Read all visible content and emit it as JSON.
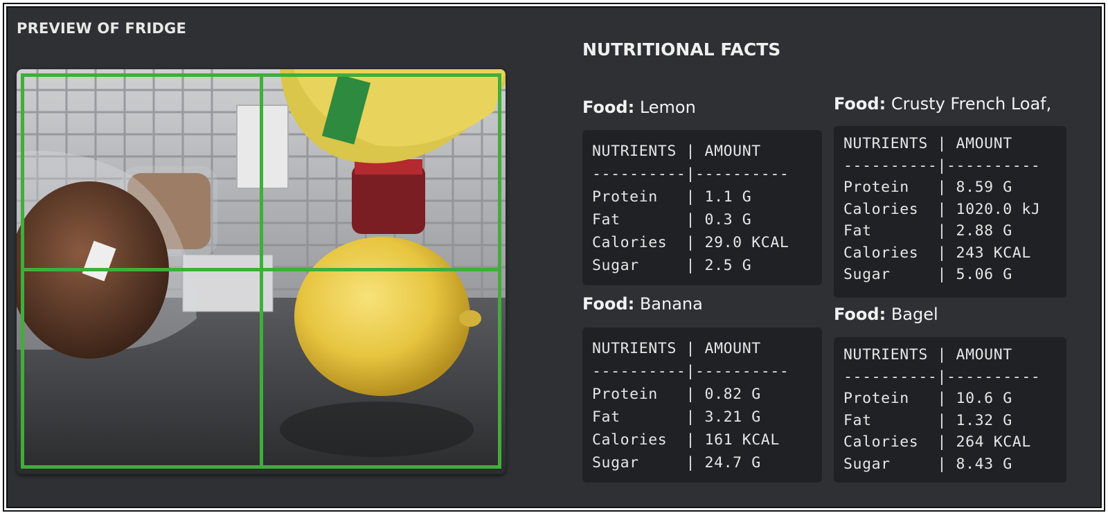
{
  "preview": {
    "title": "PREVIEW OF FRIDGE"
  },
  "colors": {
    "background": "#2f3034",
    "grid": "#3fae3a",
    "code_bg": "#202124"
  },
  "facts": {
    "title": "NUTRITIONAL FACTS",
    "food_prefix": "Food:",
    "items": [
      {
        "name": "Lemon",
        "lines": [
          "NUTRIENTS | AMOUNT",
          "----------|----------",
          "Protein   | 1.1 G",
          "Fat       | 0.3 G",
          "Calories  | 29.0 KCAL",
          "Sugar     | 2.5 G"
        ]
      },
      {
        "name": "Crusty French Loaf,",
        "lines": [
          "NUTRIENTS | AMOUNT",
          "----------|----------",
          "Protein   | 8.59 G",
          "Calories  | 1020.0 kJ",
          "Fat       | 2.88 G",
          "Calories  | 243 KCAL",
          "Sugar     | 5.06 G"
        ]
      },
      {
        "name": "Banana",
        "lines": [
          "NUTRIENTS | AMOUNT",
          "----------|----------",
          "Protein   | 0.82 G",
          "Fat       | 3.21 G",
          "Calories  | 161 KCAL",
          "Sugar     | 24.7 G"
        ]
      },
      {
        "name": "Bagel",
        "lines": [
          "NUTRIENTS | AMOUNT",
          "----------|----------",
          "Protein   | 10.6 G",
          "Fat       | 1.32 G",
          "Calories  | 264 KCAL",
          "Sugar     | 8.43 G"
        ]
      }
    ]
  }
}
